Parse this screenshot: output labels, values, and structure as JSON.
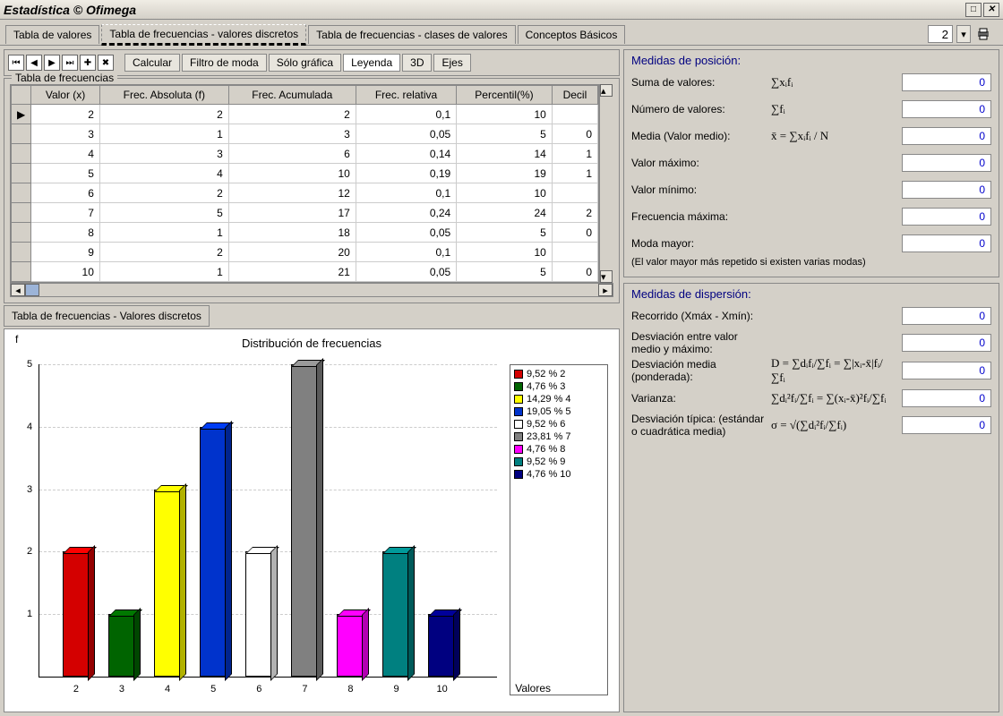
{
  "window": {
    "title": "Estadística © Ofimega"
  },
  "tabs": {
    "main": [
      "Tabla de valores",
      "Tabla de frecuencias - valores discretos",
      "Tabla de frecuencias - clases de valores",
      "Conceptos Básicos"
    ],
    "active": 1,
    "zoom_value": "2"
  },
  "toolbar": {
    "calcular": "Calcular",
    "filtro": "Filtro de moda",
    "solo_grafica": "Sólo gráfica",
    "leyenda": "Leyenda",
    "tres_d": "3D",
    "ejes": "Ejes"
  },
  "freq_table": {
    "title": "Tabla de frecuencias",
    "headers": [
      "Valor (x)",
      "Frec. Absoluta (f)",
      "Frec. Acumulada",
      "Frec. relativa",
      "Percentil(%)",
      "Decil"
    ],
    "rows": [
      [
        "2",
        "2",
        "2",
        "0,1",
        "10",
        ""
      ],
      [
        "3",
        "1",
        "3",
        "0,05",
        "5",
        "0"
      ],
      [
        "4",
        "3",
        "6",
        "0,14",
        "14",
        "1"
      ],
      [
        "5",
        "4",
        "10",
        "0,19",
        "19",
        "1"
      ],
      [
        "6",
        "2",
        "12",
        "0,1",
        "10",
        ""
      ],
      [
        "7",
        "5",
        "17",
        "0,24",
        "24",
        "2"
      ],
      [
        "8",
        "1",
        "18",
        "0,05",
        "5",
        "0"
      ],
      [
        "9",
        "2",
        "20",
        "0,1",
        "10",
        ""
      ],
      [
        "10",
        "1",
        "21",
        "0,05",
        "5",
        "0"
      ]
    ],
    "footer_tab": "Tabla de frecuencias - Valores discretos"
  },
  "chart_data": {
    "type": "bar",
    "title": "Distribución de frecuencias",
    "xlabel": "Valores",
    "ylabel": "f",
    "categories": [
      "2",
      "3",
      "4",
      "5",
      "6",
      "7",
      "8",
      "9",
      "10"
    ],
    "values": [
      2,
      1,
      3,
      4,
      2,
      5,
      1,
      2,
      1
    ],
    "colors": [
      "#d40000",
      "#006400",
      "#ffff00",
      "#0033cc",
      "#ffffff",
      "#808080",
      "#ff00ff",
      "#008080",
      "#000080"
    ],
    "ylim": [
      0,
      5
    ],
    "legend": [
      "9,52 % 2",
      "4,76 % 3",
      "14,29 % 4",
      "19,05 % 5",
      "9,52 % 6",
      "23,81 % 7",
      "4,76 % 8",
      "9,52 % 9",
      "4,76 % 10"
    ]
  },
  "stats": {
    "posicion": {
      "hdr": "Medidas de posición:",
      "rows": [
        {
          "lbl": "Suma de valores:",
          "formula": "∑xᵢfᵢ",
          "val": "0"
        },
        {
          "lbl": "Número de valores:",
          "formula": "∑fᵢ",
          "val": "0"
        },
        {
          "lbl": "Media (Valor medio):",
          "formula": "x̄ = ∑xᵢfᵢ / N",
          "val": "0"
        },
        {
          "lbl": "Valor máximo:",
          "formula": "",
          "val": "0"
        },
        {
          "lbl": "Valor mínimo:",
          "formula": "",
          "val": "0"
        },
        {
          "lbl": "Frecuencia máxima:",
          "formula": "",
          "val": "0"
        },
        {
          "lbl": "Moda mayor:",
          "formula": "",
          "val": "0"
        }
      ],
      "note": "(El valor mayor más repetido si existen varias modas)"
    },
    "dispersion": {
      "hdr": "Medidas de dispersión:",
      "rows": [
        {
          "lbl": "Recorrido (Xmáx - Xmín):",
          "formula": "",
          "val": "0"
        },
        {
          "lbl": "Desviación entre valor medio y máximo:",
          "formula": "",
          "val": "0"
        },
        {
          "lbl": "Desviación media (ponderada):",
          "formula": "D = ∑dᵢfᵢ/∑fᵢ = ∑|xᵢ-x̄|fᵢ/∑fᵢ",
          "val": "0"
        },
        {
          "lbl": "Varianza:",
          "formula": "∑dᵢ²fᵢ/∑fᵢ = ∑(xᵢ-x̄)²fᵢ/∑fᵢ",
          "val": "0"
        },
        {
          "lbl": "Desviación típica: (estándar o cuadrática media)",
          "formula": "σ = √(∑dᵢ²fᵢ/∑fᵢ)",
          "val": "0"
        }
      ]
    }
  }
}
